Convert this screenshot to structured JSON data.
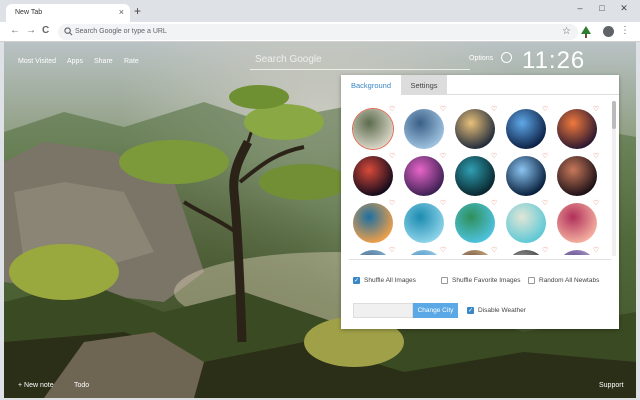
{
  "browser": {
    "tab_title": "New Tab",
    "tab_close": "×",
    "new_tab": "+",
    "window_controls": [
      "–",
      "□",
      "✕"
    ],
    "back": "←",
    "forward": "→",
    "reload": "C",
    "omnibox_placeholder": "Search Google or type a URL",
    "star": "☆",
    "menu": "⋮"
  },
  "newtab": {
    "top_links": [
      "Most Visited",
      "Apps",
      "Share",
      "Rate"
    ],
    "search_placeholder": "Search Google",
    "options_label": "Options",
    "clock": "11:26",
    "bottom_left": "+ New note",
    "bottom_todo": "Todo",
    "bottom_right": "Support"
  },
  "options_panel": {
    "tabs": [
      "Background",
      "Settings"
    ],
    "active_tab": "Background",
    "heart": "♡",
    "thumbnails": [
      {
        "colors": [
          "#d9d6c8",
          "#5b6b4c"
        ]
      },
      {
        "colors": [
          "#9fc3e0",
          "#3a5f87"
        ]
      },
      {
        "colors": [
          "#1f2a3b",
          "#e8c07a"
        ]
      },
      {
        "colors": [
          "#0b1f45",
          "#5fa8e8"
        ]
      },
      {
        "colors": [
          "#2a1730",
          "#f07a3d"
        ]
      },
      {
        "colors": [
          "#110a1c",
          "#d94a3a"
        ]
      },
      {
        "colors": [
          "#3b1f52",
          "#e866c9"
        ]
      },
      {
        "colors": [
          "#08242c",
          "#2f9fb2"
        ]
      },
      {
        "colors": [
          "#061d3a",
          "#8bc4f0"
        ]
      },
      {
        "colors": [
          "#1a0f16",
          "#c8795a"
        ]
      },
      {
        "colors": [
          "#f0a04a",
          "#1e6fa0"
        ]
      },
      {
        "colors": [
          "#8ed4ea",
          "#1c8bb0"
        ]
      },
      {
        "colors": [
          "#4fc3e0",
          "#2e8f5a"
        ]
      },
      {
        "colors": [
          "#5cc8d6",
          "#e2e6d6"
        ]
      },
      {
        "colors": [
          "#f5b0a0",
          "#b0305a"
        ]
      },
      {
        "colors": [
          "#98c8e8",
          "#406080"
        ]
      },
      {
        "colors": [
          "#b8e0f0",
          "#3d88c0"
        ]
      },
      {
        "colors": [
          "#e8d0a0",
          "#5a3a2a"
        ]
      },
      {
        "colors": [
          "#2a2a2a",
          "#aaaaaa"
        ]
      },
      {
        "colors": [
          "#c8b0e0",
          "#4a3a7a"
        ]
      }
    ],
    "shuffle_all": {
      "label": "Shuffle All Images",
      "checked": true
    },
    "shuffle_fav": {
      "label": "Shuffle Favorite Images",
      "checked": false
    },
    "random_all": {
      "label": "Random All Newtabs",
      "checked": false
    },
    "change_city": "Change City",
    "disable_weather": {
      "label": "Disable Weather",
      "checked": true
    },
    "check_mark": "✓"
  }
}
